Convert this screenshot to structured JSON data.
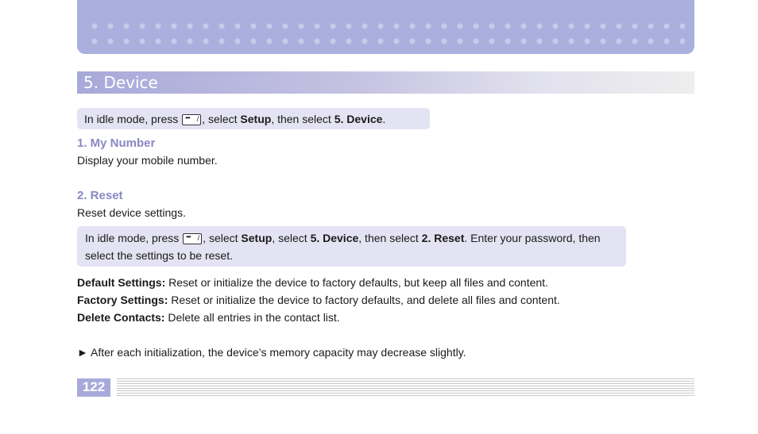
{
  "section": {
    "title": "5. Device"
  },
  "intro_box": {
    "prefix": "In idle mode, press ",
    "mid1": ", select ",
    "setup": "Setup",
    "mid2": ", then select ",
    "target": "5. Device",
    "suffix": "."
  },
  "my_number": {
    "heading": "1. My Number",
    "text": "Display your mobile number."
  },
  "reset": {
    "heading": "2. Reset",
    "text": "Reset device settings.",
    "box": {
      "prefix": "In idle mode, press ",
      "mid1": ", select ",
      "setup": "Setup",
      "mid2": ", select ",
      "device": "5. Device",
      "mid3": ", then select ",
      "reset": "2. Reset",
      "suffix": ". Enter your password, then select the settings to be reset."
    }
  },
  "definitions": [
    {
      "term": "Default Settings:",
      "desc": " Reset or initialize the device to factory defaults, but keep all files and content."
    },
    {
      "term": "Factory Settings:",
      "desc": " Reset or initialize the device to factory defaults, and delete all files and content."
    },
    {
      "term": "Delete Contacts:",
      "desc": " Delete all entries in the contact list."
    }
  ],
  "note": {
    "marker": "►",
    "text": " After each initialization, the device’s memory capacity may decrease slightly."
  },
  "footer": {
    "page_number": "122"
  },
  "icons": {
    "menu_key": "menu-softkey-icon"
  },
  "colors": {
    "banner": "#aab0de",
    "heading": "#8a88c3",
    "box": "#e4e3f3"
  }
}
